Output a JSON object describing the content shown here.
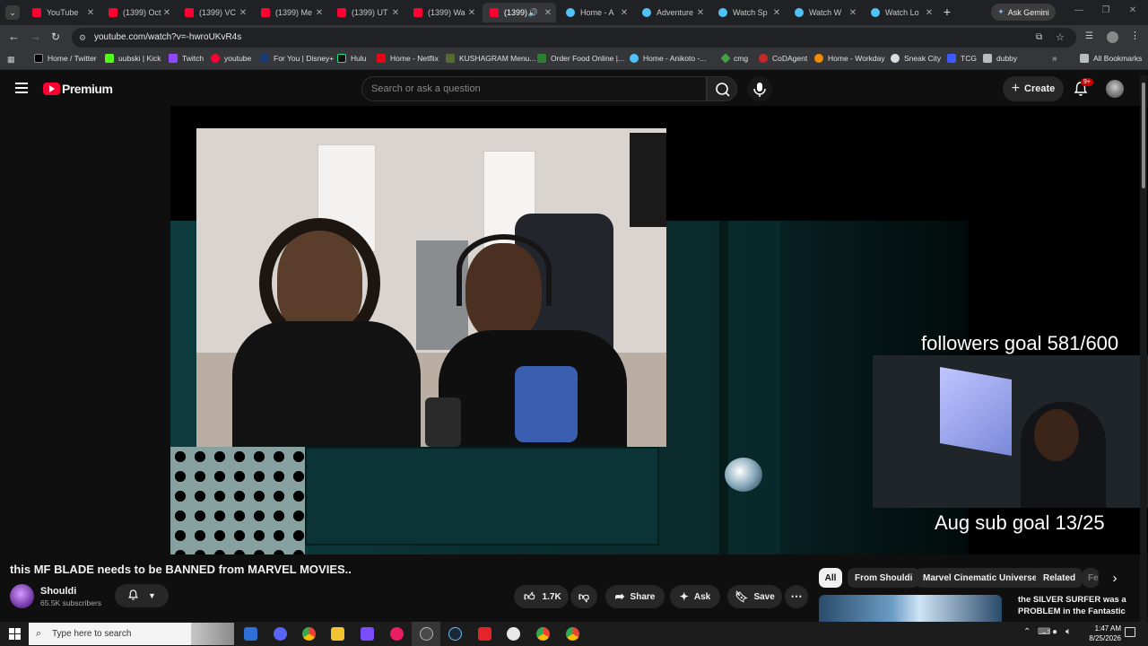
{
  "browser": {
    "tabs": [
      {
        "title": "YouTube",
        "icon": "youtube-icon"
      },
      {
        "title": "(1399) Oct",
        "icon": "youtube-icon"
      },
      {
        "title": "(1399) VC",
        "icon": "youtube-icon"
      },
      {
        "title": "(1399) Me",
        "icon": "youtube-icon"
      },
      {
        "title": "(1399) UT",
        "icon": "youtube-icon"
      },
      {
        "title": "(1399) Wa",
        "icon": "youtube-icon"
      },
      {
        "title": "(1399)",
        "icon": "youtube-icon"
      },
      {
        "title": "Home - A",
        "icon": "globe-icon"
      },
      {
        "title": "Adventure",
        "icon": "globe-icon"
      },
      {
        "title": "Watch Sp",
        "icon": "globe-icon"
      },
      {
        "title": "Watch W",
        "icon": "globe-icon"
      },
      {
        "title": "Watch Lo",
        "icon": "globe-icon"
      }
    ],
    "ask_gemini": "Ask Gemini",
    "url": "youtube.com/watch?v=-hwroUKvR4s",
    "bookmarks": [
      "Home / Twitter",
      "uubski | Kick",
      "Twitch",
      "youtube",
      "For You | Disney+",
      "Hulu",
      "Home - Netflix",
      "KUSHAGRAM Menu...",
      "Order Food Online |...",
      "Home - Anikoto -...",
      "cmg",
      "CoDAgent",
      "Home - Workday",
      "Sneak City",
      "TCG",
      "dubby"
    ],
    "all_bookmarks": "All Bookmarks"
  },
  "youtube": {
    "logo_text": "Premium",
    "search_placeholder": "Search or ask a question",
    "create_label": "Create",
    "notifications_badge": "9+"
  },
  "video": {
    "overlay_followers": "followers goal 581/600",
    "overlay_subs": "Aug sub goal 13/25",
    "title": "this MF BLADE needs to be BANNED from MARVEL MOVIES..",
    "channel_name": "Shouldi",
    "subscribers": "65.5K subscribers",
    "like_count": "1.7K",
    "share_label": "Share",
    "ask_label": "Ask",
    "save_label": "Save"
  },
  "sidebar": {
    "chips": [
      "All",
      "From Shouldi",
      "Marvel Cinematic Universe",
      "Related",
      "Fe"
    ],
    "rec_title_line1": "the SILVER SURFER was a",
    "rec_title_line2": "PROBLEM in the Fantastic"
  },
  "taskbar": {
    "search_placeholder": "Type here to search",
    "time": "1:47 AM",
    "date": "8/25/2026"
  }
}
